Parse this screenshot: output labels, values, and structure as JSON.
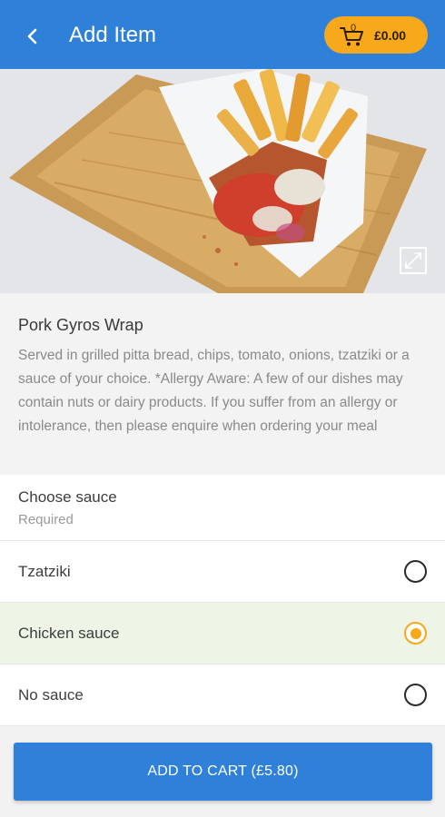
{
  "header": {
    "back_icon": "chevron-left-icon",
    "title": "Add Item",
    "cart": {
      "icon": "cart-icon",
      "count": "0",
      "amount": "£0.00",
      "color": "#f7a81b"
    },
    "color": "#2f80d9"
  },
  "hero": {
    "image_icon": "pork-gyros-wrap-photo",
    "expand_icon": "expand-icon"
  },
  "item": {
    "name": "Pork Gyros Wrap",
    "description": "Served in grilled pitta bread, chips, tomato,  onions, tzatziki or a sauce of your choice. *Allergy Aware: A few of our dishes may contain nuts or dairy products. If you suffer from an allergy or intolerance, then please enquire when ordering your meal"
  },
  "sauce_section": {
    "title": "Choose sauce",
    "subtitle": "Required",
    "options": [
      {
        "label": "Tzatziki",
        "selected": false
      },
      {
        "label": "Chicken sauce",
        "selected": true
      },
      {
        "label": "No sauce",
        "selected": false
      }
    ]
  },
  "footer": {
    "add_to_cart_label": "ADD TO CART  (£5.80)"
  }
}
